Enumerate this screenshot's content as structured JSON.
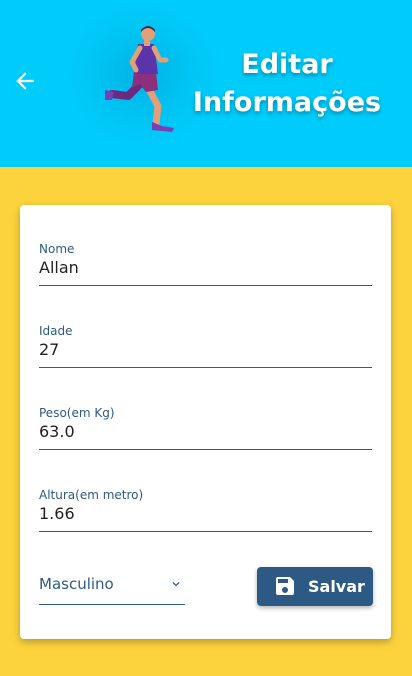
{
  "header": {
    "title_line1": "Editar",
    "title_line2": "Informações"
  },
  "form": {
    "name": {
      "label": "Nome",
      "value": "Allan"
    },
    "age": {
      "label": "Idade",
      "value": "27"
    },
    "weight": {
      "label": "Peso(em Kg)",
      "value": "63.0"
    },
    "height": {
      "label": "Altura(em metro)",
      "value": "1.66"
    },
    "sex": {
      "value": "Masculino"
    },
    "save_label": "Salvar"
  },
  "icons": {
    "back": "arrow-left-icon",
    "runner": "runner-illustration",
    "select": "chevron-down-icon",
    "save": "floppy-disk-icon"
  },
  "colors": {
    "header_bg": "#00CCFB",
    "page_bg": "#FDD33D",
    "accent": "#2C5A84",
    "card_bg": "#FFFFFF"
  }
}
